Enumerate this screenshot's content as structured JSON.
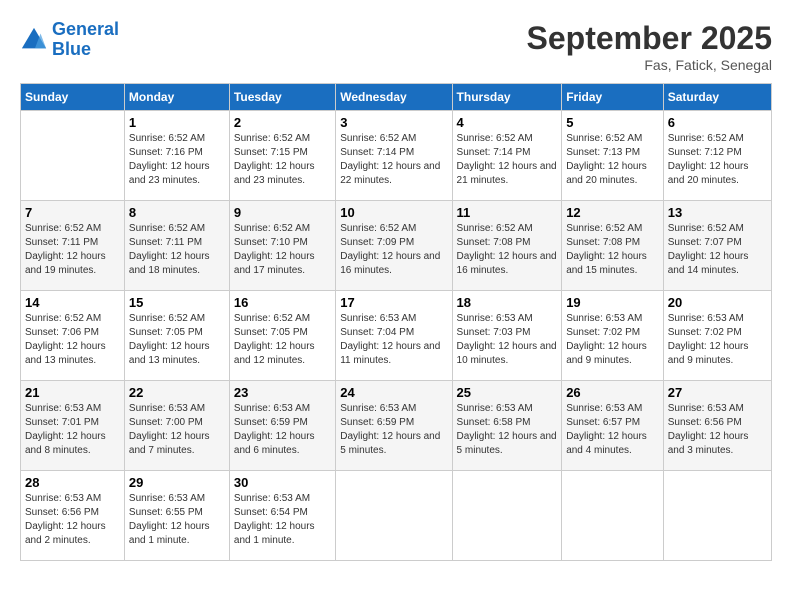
{
  "header": {
    "logo_line1": "General",
    "logo_line2": "Blue",
    "month": "September 2025",
    "location": "Fas, Fatick, Senegal"
  },
  "weekdays": [
    "Sunday",
    "Monday",
    "Tuesday",
    "Wednesday",
    "Thursday",
    "Friday",
    "Saturday"
  ],
  "weeks": [
    [
      null,
      {
        "day": "1",
        "sunrise": "6:52 AM",
        "sunset": "7:16 PM",
        "daylight": "12 hours and 23 minutes."
      },
      {
        "day": "2",
        "sunrise": "6:52 AM",
        "sunset": "7:15 PM",
        "daylight": "12 hours and 23 minutes."
      },
      {
        "day": "3",
        "sunrise": "6:52 AM",
        "sunset": "7:14 PM",
        "daylight": "12 hours and 22 minutes."
      },
      {
        "day": "4",
        "sunrise": "6:52 AM",
        "sunset": "7:14 PM",
        "daylight": "12 hours and 21 minutes."
      },
      {
        "day": "5",
        "sunrise": "6:52 AM",
        "sunset": "7:13 PM",
        "daylight": "12 hours and 20 minutes."
      },
      {
        "day": "6",
        "sunrise": "6:52 AM",
        "sunset": "7:12 PM",
        "daylight": "12 hours and 20 minutes."
      }
    ],
    [
      {
        "day": "7",
        "sunrise": "6:52 AM",
        "sunset": "7:11 PM",
        "daylight": "12 hours and 19 minutes."
      },
      {
        "day": "8",
        "sunrise": "6:52 AM",
        "sunset": "7:11 PM",
        "daylight": "12 hours and 18 minutes."
      },
      {
        "day": "9",
        "sunrise": "6:52 AM",
        "sunset": "7:10 PM",
        "daylight": "12 hours and 17 minutes."
      },
      {
        "day": "10",
        "sunrise": "6:52 AM",
        "sunset": "7:09 PM",
        "daylight": "12 hours and 16 minutes."
      },
      {
        "day": "11",
        "sunrise": "6:52 AM",
        "sunset": "7:08 PM",
        "daylight": "12 hours and 16 minutes."
      },
      {
        "day": "12",
        "sunrise": "6:52 AM",
        "sunset": "7:08 PM",
        "daylight": "12 hours and 15 minutes."
      },
      {
        "day": "13",
        "sunrise": "6:52 AM",
        "sunset": "7:07 PM",
        "daylight": "12 hours and 14 minutes."
      }
    ],
    [
      {
        "day": "14",
        "sunrise": "6:52 AM",
        "sunset": "7:06 PM",
        "daylight": "12 hours and 13 minutes."
      },
      {
        "day": "15",
        "sunrise": "6:52 AM",
        "sunset": "7:05 PM",
        "daylight": "12 hours and 13 minutes."
      },
      {
        "day": "16",
        "sunrise": "6:52 AM",
        "sunset": "7:05 PM",
        "daylight": "12 hours and 12 minutes."
      },
      {
        "day": "17",
        "sunrise": "6:53 AM",
        "sunset": "7:04 PM",
        "daylight": "12 hours and 11 minutes."
      },
      {
        "day": "18",
        "sunrise": "6:53 AM",
        "sunset": "7:03 PM",
        "daylight": "12 hours and 10 minutes."
      },
      {
        "day": "19",
        "sunrise": "6:53 AM",
        "sunset": "7:02 PM",
        "daylight": "12 hours and 9 minutes."
      },
      {
        "day": "20",
        "sunrise": "6:53 AM",
        "sunset": "7:02 PM",
        "daylight": "12 hours and 9 minutes."
      }
    ],
    [
      {
        "day": "21",
        "sunrise": "6:53 AM",
        "sunset": "7:01 PM",
        "daylight": "12 hours and 8 minutes."
      },
      {
        "day": "22",
        "sunrise": "6:53 AM",
        "sunset": "7:00 PM",
        "daylight": "12 hours and 7 minutes."
      },
      {
        "day": "23",
        "sunrise": "6:53 AM",
        "sunset": "6:59 PM",
        "daylight": "12 hours and 6 minutes."
      },
      {
        "day": "24",
        "sunrise": "6:53 AM",
        "sunset": "6:59 PM",
        "daylight": "12 hours and 5 minutes."
      },
      {
        "day": "25",
        "sunrise": "6:53 AM",
        "sunset": "6:58 PM",
        "daylight": "12 hours and 5 minutes."
      },
      {
        "day": "26",
        "sunrise": "6:53 AM",
        "sunset": "6:57 PM",
        "daylight": "12 hours and 4 minutes."
      },
      {
        "day": "27",
        "sunrise": "6:53 AM",
        "sunset": "6:56 PM",
        "daylight": "12 hours and 3 minutes."
      }
    ],
    [
      {
        "day": "28",
        "sunrise": "6:53 AM",
        "sunset": "6:56 PM",
        "daylight": "12 hours and 2 minutes."
      },
      {
        "day": "29",
        "sunrise": "6:53 AM",
        "sunset": "6:55 PM",
        "daylight": "12 hours and 1 minute."
      },
      {
        "day": "30",
        "sunrise": "6:53 AM",
        "sunset": "6:54 PM",
        "daylight": "12 hours and 1 minute."
      },
      null,
      null,
      null,
      null
    ]
  ],
  "labels": {
    "sunrise_prefix": "Sunrise: ",
    "sunset_prefix": "Sunset: ",
    "daylight_prefix": "Daylight: "
  }
}
